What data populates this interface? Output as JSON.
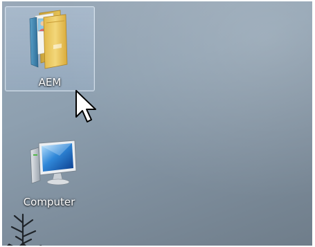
{
  "desktop": {
    "icons": [
      {
        "label": "AEM",
        "icon": "folder-icon",
        "selected": true
      },
      {
        "label": "Computer",
        "icon": "computer-icon",
        "selected": false
      }
    ]
  },
  "cursor": {
    "icon": "mouse-pointer-icon"
  }
}
